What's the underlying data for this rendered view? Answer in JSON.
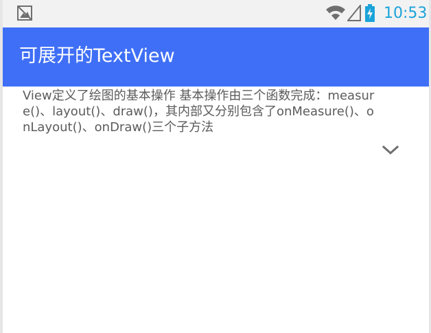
{
  "status_bar": {
    "notification_icon": "image-placeholder-icon",
    "wifi_icon": "wifi-icon",
    "signal_icon": "cell-signal-icon",
    "battery_icon": "battery-charging-icon",
    "time": "10:53",
    "time_color": "#1aa3d9"
  },
  "app_bar": {
    "title": "可展开的TextView",
    "background_color": "#3f6ff6",
    "title_color": "#ffffff"
  },
  "content": {
    "expandable_text": "View定义了绘图的基本操作 基本操作由三个函数完成：measure()、layout()、draw()，其内部又分别包含了onMeasure()、onLayout()、onDraw()三个子方法",
    "text_color": "#5b5b5b",
    "expand_icon": "chevron-down-icon"
  }
}
